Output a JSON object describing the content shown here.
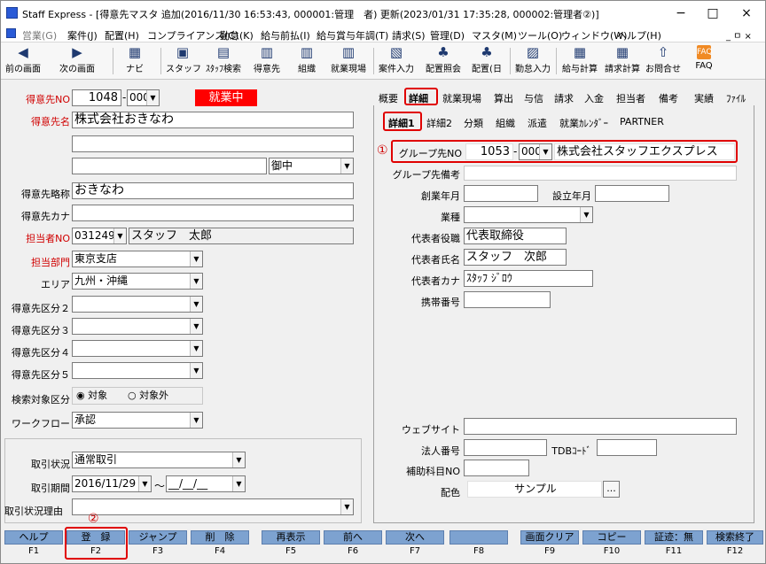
{
  "window": {
    "title": "Staff Express - [得意先マスタ 追加(2016/11/30 16:53:43, 000001:管理　者) 更新(2023/01/31 17:35:28, 000002:管理者②)]",
    "minimize": "−",
    "maximize": "□",
    "close": "×"
  },
  "menu": {
    "items": [
      "営業(G)",
      "案件(J)",
      "配置(H)",
      "コンプライアンス(C)",
      "勤怠(K)",
      "給与前払(I)",
      "給与賞与年調(T)",
      "請求(S)",
      "管理(D)",
      "マスタ(M)",
      "ツール(O)",
      "ウィンドウ(W)",
      "ヘルプ(H)"
    ],
    "child_controls": "_ ㅁ ×"
  },
  "toolbar": {
    "items": [
      "前の画面",
      "次の画面",
      "ナビ",
      "スタッフ",
      "ｽﾀｯﾌ検索",
      "得意先",
      "組織",
      "就業現場",
      "案件入力",
      "配置照会",
      "配置(日",
      "勤怠入力",
      "給与計算",
      "請求計算",
      "お問合せ",
      "FAQ"
    ]
  },
  "left": {
    "code_label": "得意先NO",
    "code": "1048",
    "code_sub": "000",
    "status": "就業中",
    "name_label": "得意先名",
    "name": "株式会社おきなわ",
    "honorific": "御中",
    "abbr_label": "得意先略称",
    "abbr": "おきなわ",
    "kana_label": "得意先カナ",
    "kana": "",
    "staff_label": "担当者NO",
    "staff_no": "031249",
    "staff_name": "スタッフ　太郎",
    "dept_label": "担当部門",
    "dept": "東京支店",
    "area_label": "エリア",
    "area": "九州・沖縄",
    "cat2_label": "得意先区分２",
    "cat3_label": "得意先区分３",
    "cat4_label": "得意先区分４",
    "cat5_label": "得意先区分５",
    "search_label": "検索対象区分",
    "search_opt1": "対象",
    "search_opt2": "対象外",
    "workflow_label": "ワークフロー",
    "workflow": "承認",
    "deal_status_label": "取引状況",
    "deal_status": "通常取引",
    "deal_period_label": "取引期間",
    "deal_from": "2016/11/29",
    "deal_tilde": "～",
    "deal_to": "__/__/__",
    "deal_reason_label": "取引状況理由"
  },
  "tabs": {
    "main": [
      "概要",
      "詳細",
      "就業現場",
      "算出",
      "与信",
      "請求",
      "入金",
      "担当者",
      "備考",
      "実績",
      "ﾌｧｲﾙ"
    ],
    "sub": [
      "詳細1",
      "詳細2",
      "分類",
      "組織",
      "派遣",
      "就業ｶﾚﾝﾀﾞｰ",
      "PARTNER"
    ]
  },
  "right": {
    "marker1": "①",
    "group_label": "グループ先NO",
    "group_no": "1053",
    "group_sub": "000",
    "group_name": "株式会社スタッフエクスプレス",
    "group_note_label": "グループ先備考",
    "founded_label": "創業年月",
    "established_label": "設立年月",
    "industry_label": "業種",
    "rep_title_label": "代表者役職",
    "rep_title": "代表取締役",
    "rep_name_label": "代表者氏名",
    "rep_name": "スタッフ　次郎",
    "rep_kana_label": "代表者カナ",
    "rep_kana": "ｽﾀｯﾌ ｼﾞﾛｳ",
    "mobile_label": "携帯番号",
    "website_label": "ウェブサイト",
    "corp_no_label": "法人番号",
    "tdb_label": "TDBｺｰﾄﾞ",
    "sub_account_label": "補助科目NO",
    "color_label": "配色",
    "color_sample": "サンプル",
    "color_btn": "..."
  },
  "marker2": "②",
  "fkeys": [
    {
      "label": "ヘルプ",
      "key": "F1"
    },
    {
      "label": "登　録",
      "key": "F2"
    },
    {
      "label": "ジャンプ",
      "key": "F3"
    },
    {
      "label": "削　除",
      "key": "F4"
    },
    {
      "label": "再表示",
      "key": "F5"
    },
    {
      "label": "前へ",
      "key": "F6"
    },
    {
      "label": "次へ",
      "key": "F7"
    },
    {
      "label": "",
      "key": "F8"
    },
    {
      "label": "画面クリア",
      "key": "F9"
    },
    {
      "label": "コピー",
      "key": "F10"
    },
    {
      "label": "証迹：無",
      "key": "F11"
    },
    {
      "label": "検索終了",
      "key": "F12"
    }
  ],
  "colors": {
    "accent_red": "#e00000",
    "status_red": "#ff0000",
    "fkey_blue": "#7da2d0"
  }
}
